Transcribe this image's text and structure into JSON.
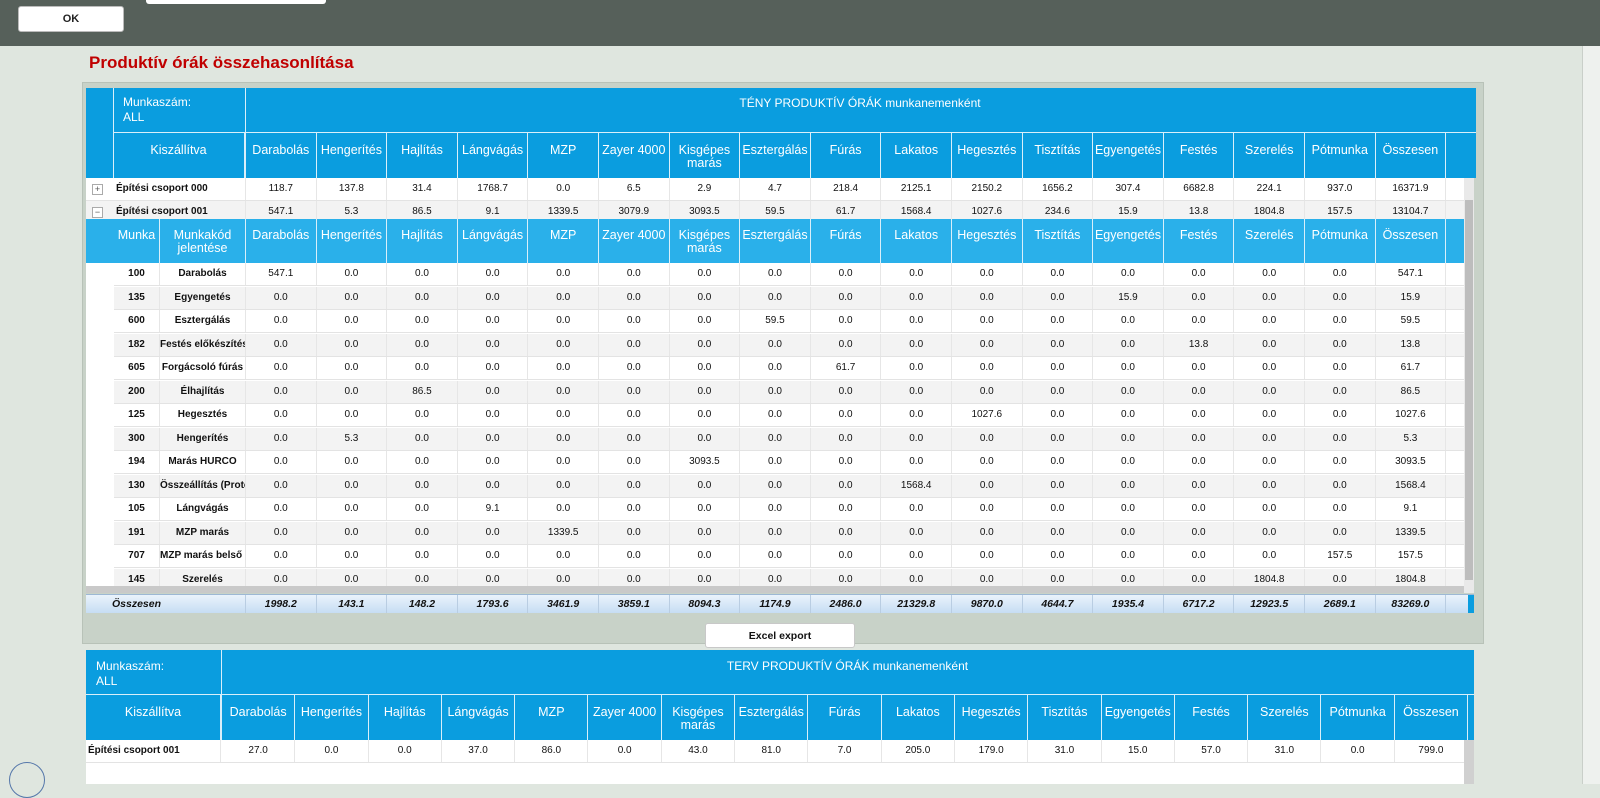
{
  "toolbar": {
    "ok_label": "OK"
  },
  "page_title": "Produktív órák összehasonlítása",
  "columns": [
    "Darabolás",
    "Hengerítés",
    "Hajlítás",
    "Lángvágás",
    "MZP",
    "Zayer 4000",
    "Kisgépes marás",
    "Esztergálás",
    "Fúrás",
    "Lakatos",
    "Hegesztés",
    "Tisztítás",
    "Egyengetés",
    "Festés",
    "Szerelés",
    "Pótmunka",
    "Összesen"
  ],
  "teny": {
    "munkaszam_label": "Munkaszám:",
    "munkaszam_value": "ALL",
    "title": "TÉNY PRODUKTÍV ÓRÁK munkanemenként",
    "kiszallitva_label": "Kiszállítva",
    "groups": [
      {
        "expander": "+",
        "name": "Építési csoport 000",
        "values": [
          "118.7",
          "137.8",
          "31.4",
          "1768.7",
          "0.0",
          "6.5",
          "2.9",
          "4.7",
          "218.4",
          "2125.1",
          "2150.2",
          "1656.2",
          "307.4",
          "6682.8",
          "224.1",
          "937.0",
          "16371.9"
        ]
      },
      {
        "expander": "−",
        "name": "Építési csoport 001",
        "values": [
          "547.1",
          "5.3",
          "86.5",
          "9.1",
          "1339.5",
          "3079.9",
          "3093.5",
          "59.5",
          "61.7",
          "1568.4",
          "1027.6",
          "234.6",
          "15.9",
          "13.8",
          "1804.8",
          "157.5",
          "13104.7"
        ]
      }
    ],
    "sub": {
      "col_munka": "Munka",
      "col_jelentese": "Munkakód jelentése",
      "rows": [
        {
          "code": "100",
          "name": "Darabolás",
          "values": [
            "547.1",
            "0.0",
            "0.0",
            "0.0",
            "0.0",
            "0.0",
            "0.0",
            "0.0",
            "0.0",
            "0.0",
            "0.0",
            "0.0",
            "0.0",
            "0.0",
            "0.0",
            "0.0",
            "547.1"
          ]
        },
        {
          "code": "135",
          "name": "Egyengetés",
          "values": [
            "0.0",
            "0.0",
            "0.0",
            "0.0",
            "0.0",
            "0.0",
            "0.0",
            "0.0",
            "0.0",
            "0.0",
            "0.0",
            "0.0",
            "15.9",
            "0.0",
            "0.0",
            "0.0",
            "15.9"
          ]
        },
        {
          "code": "600",
          "name": "Esztergálás",
          "values": [
            "0.0",
            "0.0",
            "0.0",
            "0.0",
            "0.0",
            "0.0",
            "0.0",
            "59.5",
            "0.0",
            "0.0",
            "0.0",
            "0.0",
            "0.0",
            "0.0",
            "0.0",
            "0.0",
            "59.5"
          ]
        },
        {
          "code": "182",
          "name": "Festés előkészítés",
          "values": [
            "0.0",
            "0.0",
            "0.0",
            "0.0",
            "0.0",
            "0.0",
            "0.0",
            "0.0",
            "0.0",
            "0.0",
            "0.0",
            "0.0",
            "0.0",
            "13.8",
            "0.0",
            "0.0",
            "13.8"
          ]
        },
        {
          "code": "605",
          "name": "Forgácsoló fúrás",
          "values": [
            "0.0",
            "0.0",
            "0.0",
            "0.0",
            "0.0",
            "0.0",
            "0.0",
            "0.0",
            "61.7",
            "0.0",
            "0.0",
            "0.0",
            "0.0",
            "0.0",
            "0.0",
            "0.0",
            "61.7"
          ]
        },
        {
          "code": "200",
          "name": "Élhajlítás",
          "values": [
            "0.0",
            "0.0",
            "86.5",
            "0.0",
            "0.0",
            "0.0",
            "0.0",
            "0.0",
            "0.0",
            "0.0",
            "0.0",
            "0.0",
            "0.0",
            "0.0",
            "0.0",
            "0.0",
            "86.5"
          ]
        },
        {
          "code": "125",
          "name": "Hegesztés",
          "values": [
            "0.0",
            "0.0",
            "0.0",
            "0.0",
            "0.0",
            "0.0",
            "0.0",
            "0.0",
            "0.0",
            "0.0",
            "1027.6",
            "0.0",
            "0.0",
            "0.0",
            "0.0",
            "0.0",
            "1027.6"
          ]
        },
        {
          "code": "300",
          "name": "Hengerítés",
          "values": [
            "0.0",
            "5.3",
            "0.0",
            "0.0",
            "0.0",
            "0.0",
            "0.0",
            "0.0",
            "0.0",
            "0.0",
            "0.0",
            "0.0",
            "0.0",
            "0.0",
            "0.0",
            "0.0",
            "5.3"
          ]
        },
        {
          "code": "194",
          "name": "Marás HURCO",
          "values": [
            "0.0",
            "0.0",
            "0.0",
            "0.0",
            "0.0",
            "0.0",
            "3093.5",
            "0.0",
            "0.0",
            "0.0",
            "0.0",
            "0.0",
            "0.0",
            "0.0",
            "0.0",
            "0.0",
            "3093.5"
          ]
        },
        {
          "code": "130",
          "name": "Összeállítás (Proto",
          "values": [
            "0.0",
            "0.0",
            "0.0",
            "0.0",
            "0.0",
            "0.0",
            "0.0",
            "0.0",
            "0.0",
            "1568.4",
            "0.0",
            "0.0",
            "0.0",
            "0.0",
            "0.0",
            "0.0",
            "1568.4"
          ]
        },
        {
          "code": "105",
          "name": "Lángvágás",
          "values": [
            "0.0",
            "0.0",
            "0.0",
            "9.1",
            "0.0",
            "0.0",
            "0.0",
            "0.0",
            "0.0",
            "0.0",
            "0.0",
            "0.0",
            "0.0",
            "0.0",
            "0.0",
            "0.0",
            "9.1"
          ]
        },
        {
          "code": "191",
          "name": "MZP marás",
          "values": [
            "0.0",
            "0.0",
            "0.0",
            "0.0",
            "1339.5",
            "0.0",
            "0.0",
            "0.0",
            "0.0",
            "0.0",
            "0.0",
            "0.0",
            "0.0",
            "0.0",
            "0.0",
            "0.0",
            "1339.5"
          ]
        },
        {
          "code": "707",
          "name": "MZP marás belső h",
          "values": [
            "0.0",
            "0.0",
            "0.0",
            "0.0",
            "0.0",
            "0.0",
            "0.0",
            "0.0",
            "0.0",
            "0.0",
            "0.0",
            "0.0",
            "0.0",
            "0.0",
            "0.0",
            "157.5",
            "157.5"
          ]
        },
        {
          "code": "145",
          "name": "Szerelés",
          "values": [
            "0.0",
            "0.0",
            "0.0",
            "0.0",
            "0.0",
            "0.0",
            "0.0",
            "0.0",
            "0.0",
            "0.0",
            "0.0",
            "0.0",
            "0.0",
            "0.0",
            "1804.8",
            "0.0",
            "1804.8"
          ]
        }
      ]
    },
    "summary_label": "Összesen",
    "summary_values": [
      "1998.2",
      "143.1",
      "148.2",
      "1793.6",
      "3461.9",
      "3859.1",
      "8094.3",
      "1174.9",
      "2486.0",
      "21329.8",
      "9870.0",
      "4644.7",
      "1935.4",
      "6717.2",
      "12923.5",
      "2689.1",
      "83269.0"
    ]
  },
  "excel_export_label": "Excel export",
  "terv": {
    "munkaszam_label": "Munkaszám:",
    "munkaszam_value": "ALL",
    "title": "TERV PRODUKTÍV ÓRÁK munkanemenként",
    "kiszallitva_label": "Kiszállítva",
    "groups": [
      {
        "name": "Építési csoport 001",
        "values": [
          "27.0",
          "0.0",
          "0.0",
          "37.0",
          "86.0",
          "0.0",
          "43.0",
          "81.0",
          "7.0",
          "205.0",
          "179.0",
          "31.0",
          "15.0",
          "57.0",
          "31.0",
          "0.0",
          "799.0"
        ]
      }
    ]
  }
}
